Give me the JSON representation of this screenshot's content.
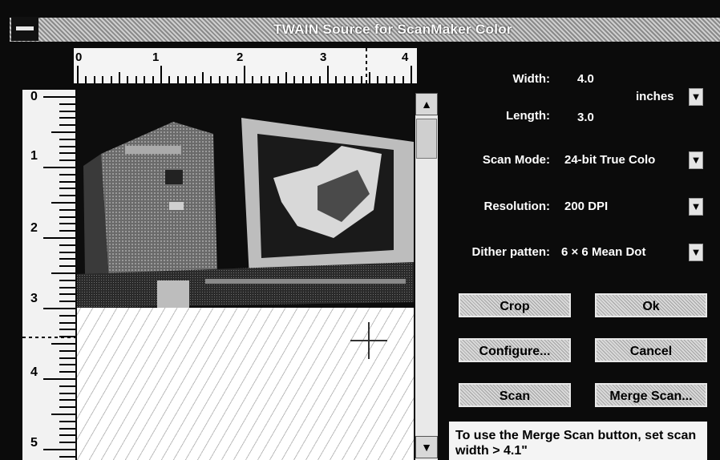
{
  "window": {
    "title": "TWAIN Source for ScanMaker Color"
  },
  "ruler": {
    "horizontal_labels": [
      "0",
      "1",
      "2",
      "3",
      "4"
    ],
    "vertical_labels": [
      "0",
      "1",
      "2",
      "3",
      "4",
      "5"
    ]
  },
  "settings": {
    "width_label": "Width:",
    "width_value": "4.0",
    "length_label": "Length:",
    "length_value": "3.0",
    "units_value": "inches",
    "scan_mode_label": "Scan Mode:",
    "scan_mode_value": "24-bit True Colo",
    "resolution_label": "Resolution:",
    "resolution_value": "200 DPI",
    "dither_label": "Dither patten:",
    "dither_value": "6 × 6 Mean Dot"
  },
  "buttons": {
    "crop": "Crop",
    "ok": "Ok",
    "configure": "Configure...",
    "cancel": "Cancel",
    "scan": "Scan",
    "merge_scan": "Merge Scan..."
  },
  "info": {
    "text": "To use the Merge Scan button, set scan width > 4.1\""
  },
  "icons": {
    "dropdown": "dropdown-arrow-icon",
    "scroll_up": "scroll-up-arrow-icon",
    "scroll_down": "scroll-down-arrow-icon",
    "system_menu": "system-menu-icon"
  }
}
